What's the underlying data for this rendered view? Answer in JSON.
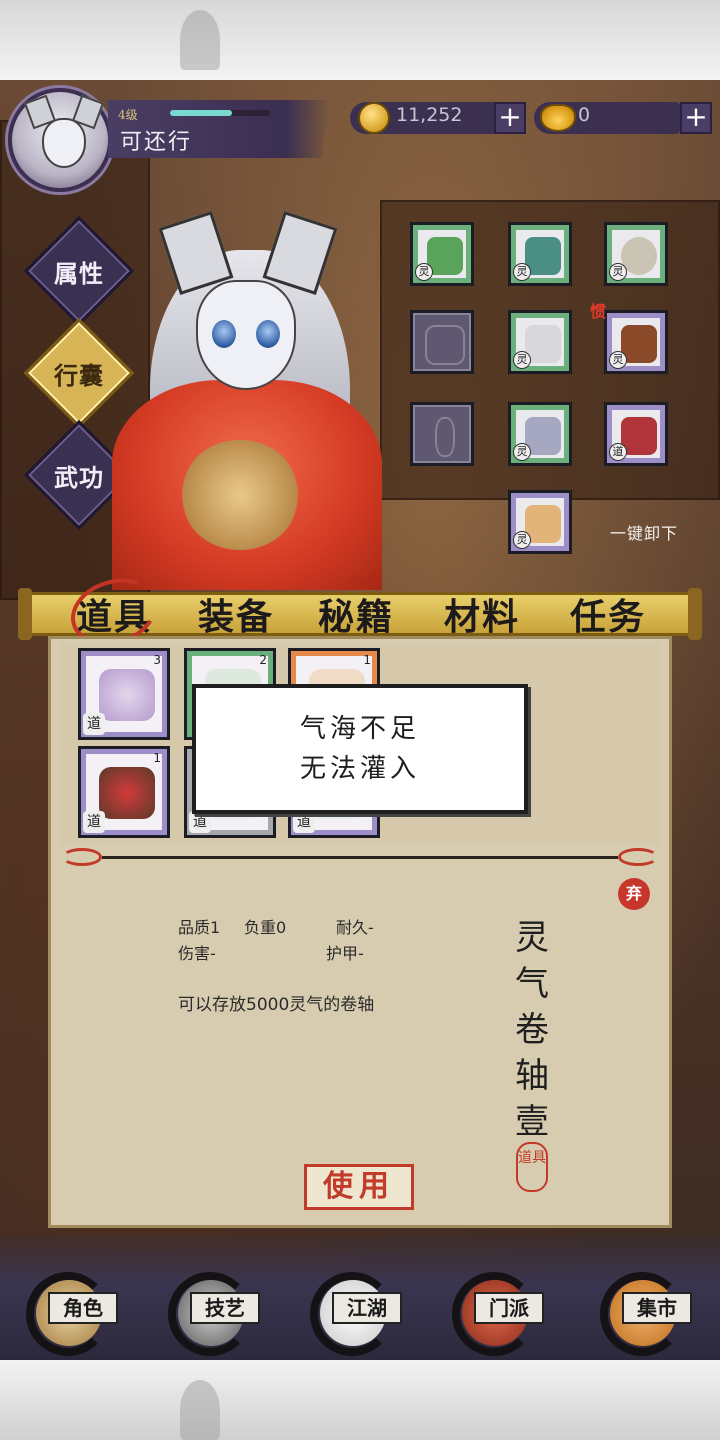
{
  "header": {
    "level": "4级",
    "exp_fraction": 0.62,
    "player_name": "可还行"
  },
  "currency": {
    "coins": "11,252",
    "ingots": "0",
    "plus": "+"
  },
  "side_menu": [
    {
      "label": "属性",
      "active": false
    },
    {
      "label": "行囊",
      "active": true
    },
    {
      "label": "武功",
      "active": false
    }
  ],
  "equipment": {
    "slot_tag": "灵",
    "badge": "惯",
    "unequip_all": "一键卸下",
    "dao_tag": "道"
  },
  "tabs": [
    "道具",
    "装备",
    "秘籍",
    "材料",
    "任务"
  ],
  "active_tab": "道具",
  "inventory": [
    {
      "count": "3",
      "tag": "道",
      "rarity": "purple"
    },
    {
      "count": "2",
      "tag": "",
      "rarity": "green"
    },
    {
      "count": "1",
      "tag": "",
      "rarity": "orange"
    },
    {
      "count": "1",
      "tag": "道",
      "rarity": "purple"
    },
    {
      "count": "",
      "tag": "道",
      "rarity": "grey"
    },
    {
      "count": "",
      "tag": "道",
      "rarity": "purple"
    }
  ],
  "toast": {
    "line1": "气海不足",
    "line2": "无法灌入"
  },
  "detail": {
    "discard": "弃",
    "quality": "品质1",
    "weight": "负重0",
    "durability": "耐久-",
    "damage": "伤害-",
    "armor": "护甲-",
    "description": "可以存放5000灵气的卷轴",
    "title": "灵气卷轴壹",
    "seal": "道具",
    "use_button": "使用"
  },
  "nav": [
    {
      "label": "角色"
    },
    {
      "label": "技艺"
    },
    {
      "label": "江湖"
    },
    {
      "label": "门派"
    },
    {
      "label": "集市"
    }
  ],
  "colors": {
    "accent_red": "#c23a2a",
    "menu_purple": "#3a3052",
    "active_gold": "#d7b556"
  }
}
